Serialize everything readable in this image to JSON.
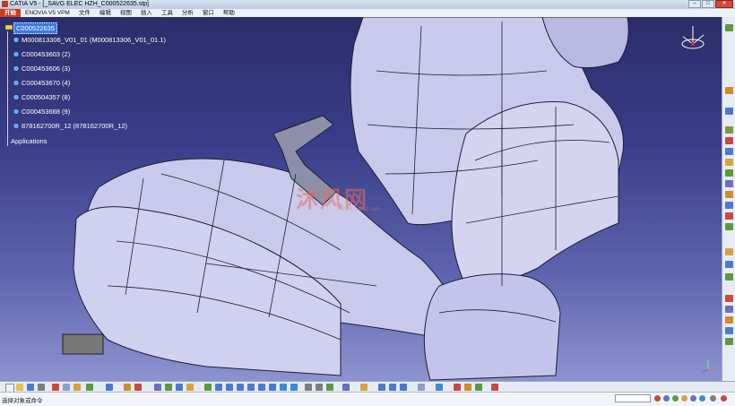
{
  "window": {
    "title": "CATIA V5 - [_SAVG ELEC HZH_C000522635.stp]",
    "minimize_label": "–",
    "maximize_label": "□",
    "close_label": "✕"
  },
  "menu": {
    "items": [
      "开始",
      "ENOVIA V5 VPM",
      "文件",
      "编辑",
      "视图",
      "插入",
      "工具",
      "分析",
      "窗口",
      "帮助"
    ]
  },
  "tree": {
    "root": "C000522635",
    "children": [
      "M000813306_V01_01 (M000813306_V01_01.1)",
      "C000453603 (2)",
      "C000453606 (3)",
      "C000453670 (4)",
      "C000504357 (8)",
      "C000453668 (9)",
      "878162700R_12 (878162700R_12)"
    ],
    "applications": "Applications"
  },
  "watermark": {
    "text": "沐风网",
    "subtext": "www.mfcad.com"
  },
  "status": {
    "prompt": "选择对象或命令"
  },
  "colors": {
    "tree_selection": "#3a7be0",
    "start_menu": "#d43a1a",
    "model_fill": "#c9c9ec",
    "model_edges": "#1c1c3a",
    "viewport_top": "#2b2d6b",
    "viewport_bottom": "#8d93cf"
  },
  "icons": {
    "compass": "compass-icon",
    "product": "product-icon",
    "part": "part-icon",
    "axis": "axis-system-icon"
  }
}
